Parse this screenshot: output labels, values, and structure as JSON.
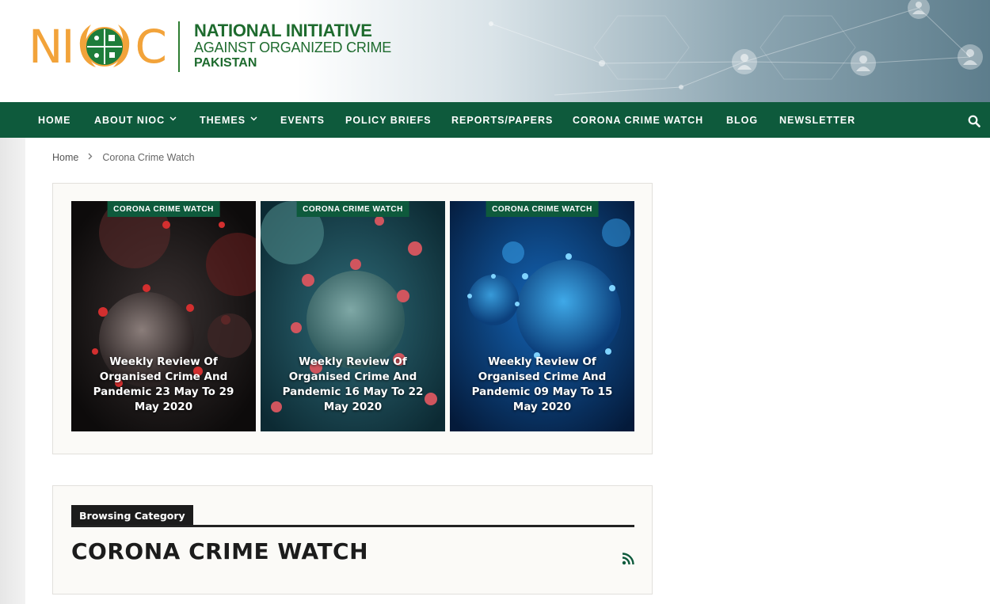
{
  "header": {
    "logo_mark": {
      "left": "NI",
      "right": "C"
    },
    "logo_text": {
      "line1": "NATIONAL INITIATIVE",
      "line2": "AGAINST ORGANIZED CRIME",
      "line3": "PAKISTAN"
    }
  },
  "nav": {
    "items": [
      {
        "label": "HOME",
        "has_dropdown": false
      },
      {
        "label": "ABOUT NIOC",
        "has_dropdown": true
      },
      {
        "label": "THEMES",
        "has_dropdown": true
      },
      {
        "label": "EVENTS",
        "has_dropdown": false
      },
      {
        "label": "POLICY BRIEFS",
        "has_dropdown": false
      },
      {
        "label": "REPORTS/PAPERS",
        "has_dropdown": false
      },
      {
        "label": "CORONA CRIME WATCH",
        "has_dropdown": false,
        "active": true
      },
      {
        "label": "BLOG",
        "has_dropdown": false
      },
      {
        "label": "NEWSLETTER",
        "has_dropdown": false
      }
    ],
    "search_icon": "search-icon"
  },
  "breadcrumb": {
    "home": "Home",
    "separator_icon": "chevron-right-icon",
    "current": "Corona Crime Watch"
  },
  "featured": {
    "cards": [
      {
        "badge": "CORONA CRIME WATCH",
        "title": "Weekly Review Of Organised Crime And Pandemic 23 May To 29 May 2020",
        "image": "coronavirus-dark-red"
      },
      {
        "badge": "CORONA CRIME WATCH",
        "title": "Weekly Review Of Organised Crime And Pandemic 16 May To 22 May 2020",
        "image": "coronavirus-teal-red"
      },
      {
        "badge": "CORONA CRIME WATCH",
        "title": "Weekly Review Of Organised Crime And Pandemic 09 May To 15 May 2020",
        "image": "coronavirus-blue"
      }
    ]
  },
  "category": {
    "label": "Browsing Category",
    "title": "CORONA CRIME WATCH",
    "rss_icon": "rss-icon"
  },
  "colors": {
    "nav_bg": "#0e5a3c",
    "logo_green": "#1e6b2e",
    "logo_orange": "#f2a33a",
    "badge_bg": "#0e5a3c",
    "category_label_bg": "#1c1c1c"
  }
}
